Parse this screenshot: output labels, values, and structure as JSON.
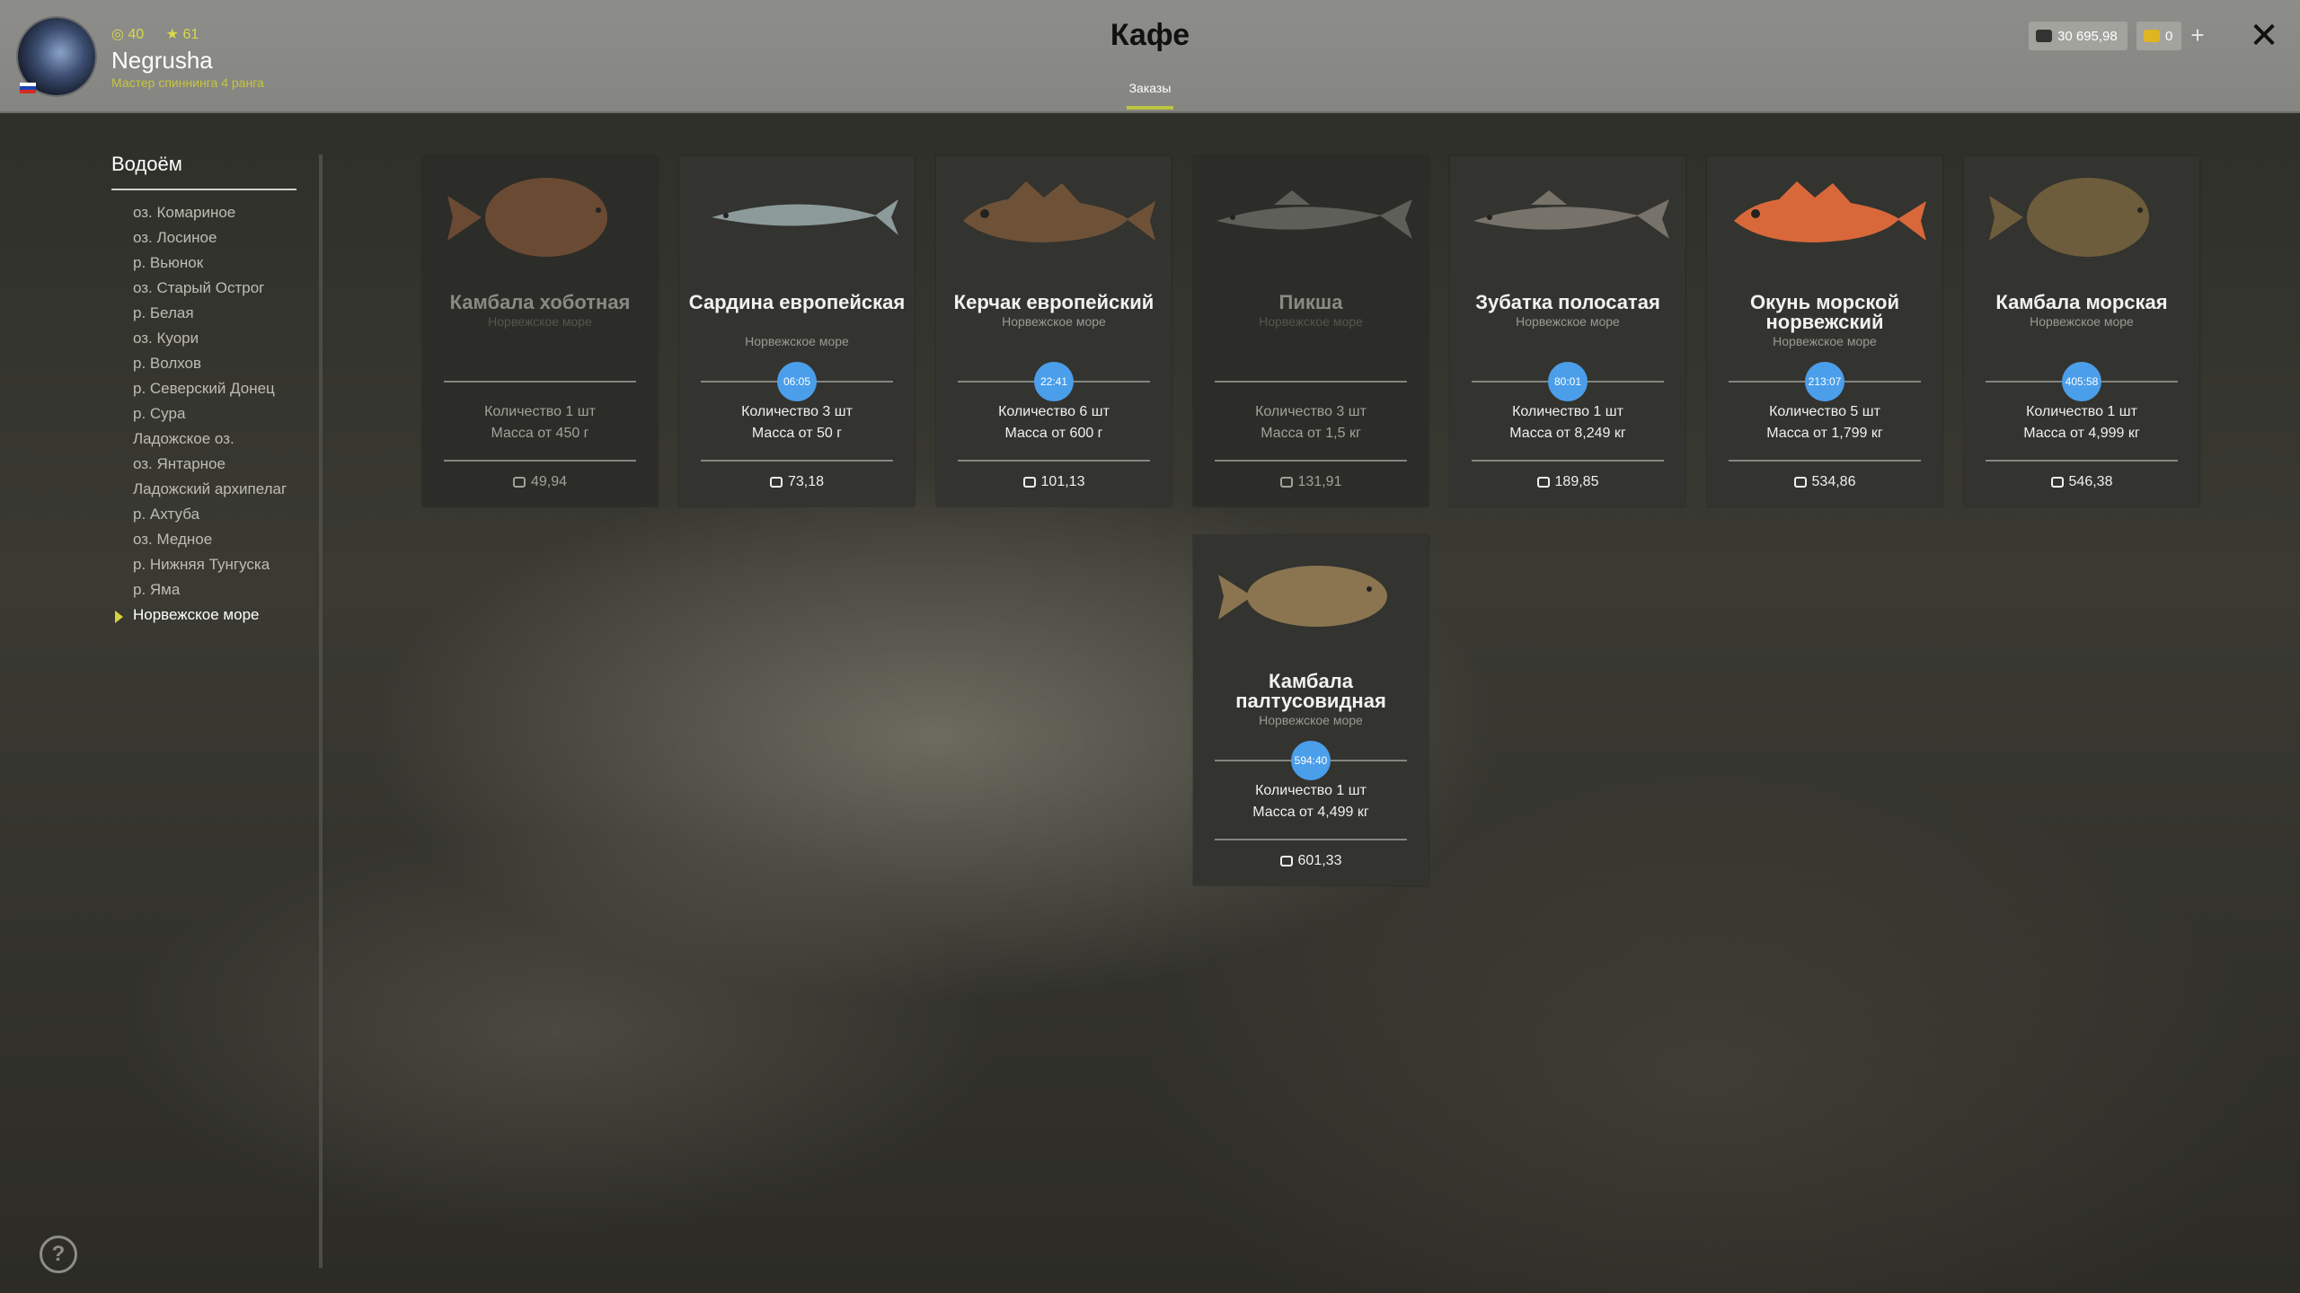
{
  "header": {
    "title": "Кафе",
    "tab_orders": "Заказы",
    "player": {
      "level": "40",
      "stars": "61",
      "name": "Negrusha",
      "rank": "Мастер спиннинга 4 ранга"
    },
    "silver": "30 695,98",
    "gold": "0",
    "plus": "+",
    "close": "✕"
  },
  "sidebar": {
    "title": "Водоём",
    "items": [
      "оз. Комариное",
      "оз. Лосиное",
      "р. Вьюнок",
      "оз. Старый Острог",
      "р. Белая",
      "оз. Куори",
      "р. Волхов",
      "р. Северский Донец",
      "р. Сура",
      "Ладожское оз.",
      "оз. Янтарное",
      "Ладожский архипелаг",
      "р. Ахтуба",
      "оз. Медное",
      "р. Нижняя Тунгуска",
      "р. Яма",
      "Норвежское море"
    ],
    "active_index": 16
  },
  "cards": [
    {
      "name": "Камбала хоботная",
      "lake": "Норвежское море",
      "timer": "",
      "qty": "Количество 1 шт",
      "mass": "Масса от 450 г",
      "price": "49,94",
      "dim": true,
      "fish": "flounder",
      "color": "#6b4a33"
    },
    {
      "name": "Сардина европейская",
      "lake": "Норвежское море",
      "timer": "06:05",
      "qty": "Количество 3 шт",
      "mass": "Масса от 50 г",
      "price": "73,18",
      "dim": false,
      "fish": "sardine",
      "color": "#8c9a9a"
    },
    {
      "name": "Керчак европейский",
      "lake": "Норвежское море",
      "timer": "22:41",
      "qty": "Количество 6 шт",
      "mass": "Масса от 600 г",
      "price": "101,13",
      "dim": false,
      "fish": "sculpin",
      "color": "#6e5238"
    },
    {
      "name": "Пикша",
      "lake": "Норвежское море",
      "timer": "",
      "qty": "Количество 3 шт",
      "mass": "Масса от 1,5 кг",
      "price": "131,91",
      "dim": true,
      "fish": "haddock",
      "color": "#5f5f5a"
    },
    {
      "name": "Зубатка полосатая",
      "lake": "Норвежское море",
      "timer": "80:01",
      "qty": "Количество 1 шт",
      "mass": "Масса от 8,249 кг",
      "price": "189,85",
      "dim": false,
      "fish": "wolffish",
      "color": "#77736a"
    },
    {
      "name": "Окунь морской норвежский",
      "lake": "Норвежское море",
      "timer": "213:07",
      "qty": "Количество 5 шт",
      "mass": "Масса от 1,799 кг",
      "price": "534,86",
      "dim": false,
      "fish": "redfish",
      "color": "#d8683a"
    },
    {
      "name": "Камбала морская",
      "lake": "Норвежское море",
      "timer": "405:58",
      "qty": "Количество 1 шт",
      "mass": "Масса от 4,999 кг",
      "price": "546,38",
      "dim": false,
      "fish": "plaice",
      "color": "#6e5d3c"
    },
    {
      "name": "Камбала палтусовидная",
      "lake": "Норвежское море",
      "timer": "594:40",
      "qty": "Количество 1 шт",
      "mass": "Масса от 4,499 кг",
      "price": "601,33",
      "dim": false,
      "fish": "dab",
      "color": "#8a7550"
    }
  ],
  "help": "?"
}
